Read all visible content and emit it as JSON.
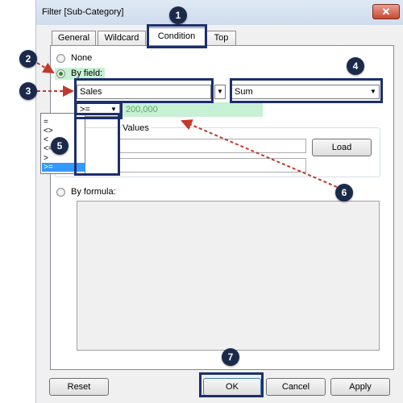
{
  "window": {
    "title": "Filter [Sub-Category]",
    "close_glyph": "✕"
  },
  "tabs": [
    {
      "label": "General"
    },
    {
      "label": "Wildcard"
    },
    {
      "label": "Condition"
    },
    {
      "label": "Top"
    }
  ],
  "condition": {
    "none_label": "None",
    "by_field_label": "By field:",
    "field_value": "Sales",
    "aggregation_value": "Sum",
    "operator_value": ">=",
    "threshold_value": "200,000",
    "operators": [
      "=",
      "<>",
      "<",
      "<=",
      ">",
      ">="
    ],
    "range_label": "Values",
    "load_label": "Load",
    "by_formula_label": "By formula:"
  },
  "footer": {
    "reset": "Reset",
    "ok": "OK",
    "cancel": "Cancel",
    "apply": "Apply"
  },
  "callouts": [
    "1",
    "2",
    "3",
    "4",
    "5",
    "6",
    "7"
  ],
  "colors": {
    "callout_bg": "#1b2a4a",
    "highlight_border": "#1c2f6d",
    "arrow_red": "#c0392b",
    "value_fill": "#c8f0d4"
  }
}
